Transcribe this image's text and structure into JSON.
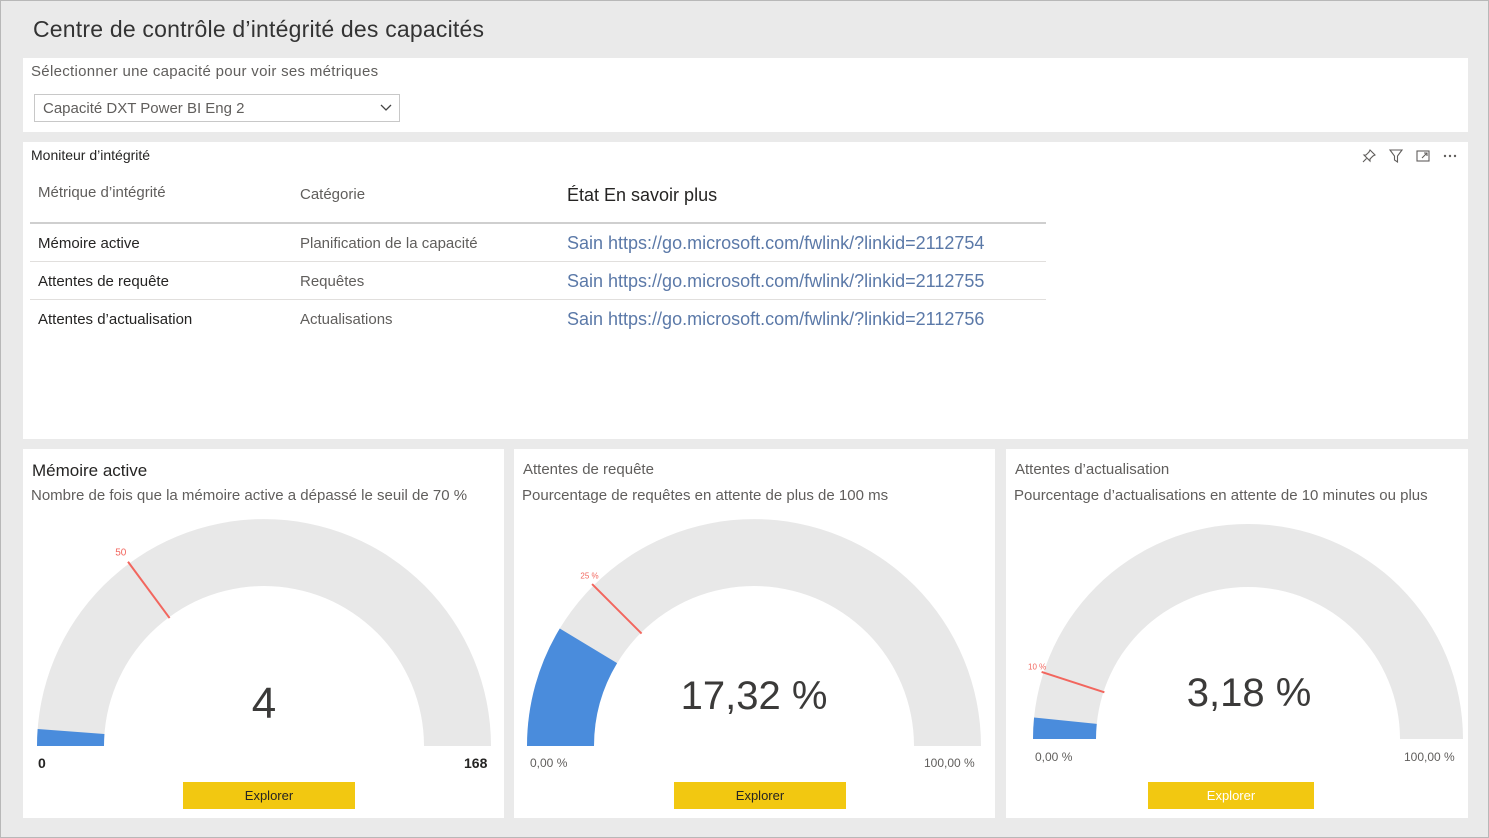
{
  "page": {
    "title": "Centre de contrôle d’intégrité des capacités"
  },
  "selector": {
    "label": "Sélectionner une capacité pour voir ses métriques",
    "value": "Capacité DXT Power BI Eng 2"
  },
  "monitor": {
    "title": "Moniteur d’intégrité",
    "headers": [
      "Métrique d’intégrité",
      "Catégorie",
      "État En savoir plus"
    ],
    "rows": [
      {
        "metric": "Mémoire active",
        "category": "Planification de la capacité",
        "status": "Sain https://go.microsoft.com/fwlink/?linkid=2112754"
      },
      {
        "metric": "Attentes de requête",
        "category": "Requêtes",
        "status": "Sain https://go.microsoft.com/fwlink/?linkid=2112755"
      },
      {
        "metric": "Attentes d’actualisation",
        "category": "Actualisations",
        "status": "Sain https://go.microsoft.com/fwlink/?linkid=2112756"
      }
    ]
  },
  "gauges": [
    {
      "title": "Mémoire active",
      "subtitle": "Nombre de fois que la mémoire active a dépassé le seuil de 70 %",
      "value": 4,
      "value_label": "4",
      "min": 0,
      "max": 168,
      "min_label": "0",
      "max_label": "168",
      "target": 50,
      "target_label": "50",
      "explore": "Explorer"
    },
    {
      "title": "Attentes de requête",
      "subtitle": "Pourcentage de requêtes en attente de plus de 100 ms",
      "value": 17.32,
      "value_label": "17,32 %",
      "min": 0,
      "max": 100,
      "min_label": "0,00 %",
      "max_label": "100,00 %",
      "target": 25,
      "target_label": "25 %",
      "explore": "Explorer"
    },
    {
      "title": "Attentes d’actualisation",
      "subtitle": "Pourcentage d’actualisations en attente de 10 minutes ou plus",
      "value": 3.18,
      "value_label": "3,18 %",
      "min": 0,
      "max": 100,
      "min_label": "0,00 %",
      "max_label": "100,00 %",
      "target": 10,
      "target_label": "10 %",
      "explore": "Explorer"
    }
  ],
  "colors": {
    "gauge_fill": "#4a8cdc",
    "gauge_track": "#e8e8e8",
    "target": "#f2665e",
    "explore_bg": "#f2c811"
  },
  "icons": [
    "pin-icon",
    "filter-icon",
    "focus-mode-icon",
    "more-options-icon",
    "chevron-down-icon"
  ]
}
